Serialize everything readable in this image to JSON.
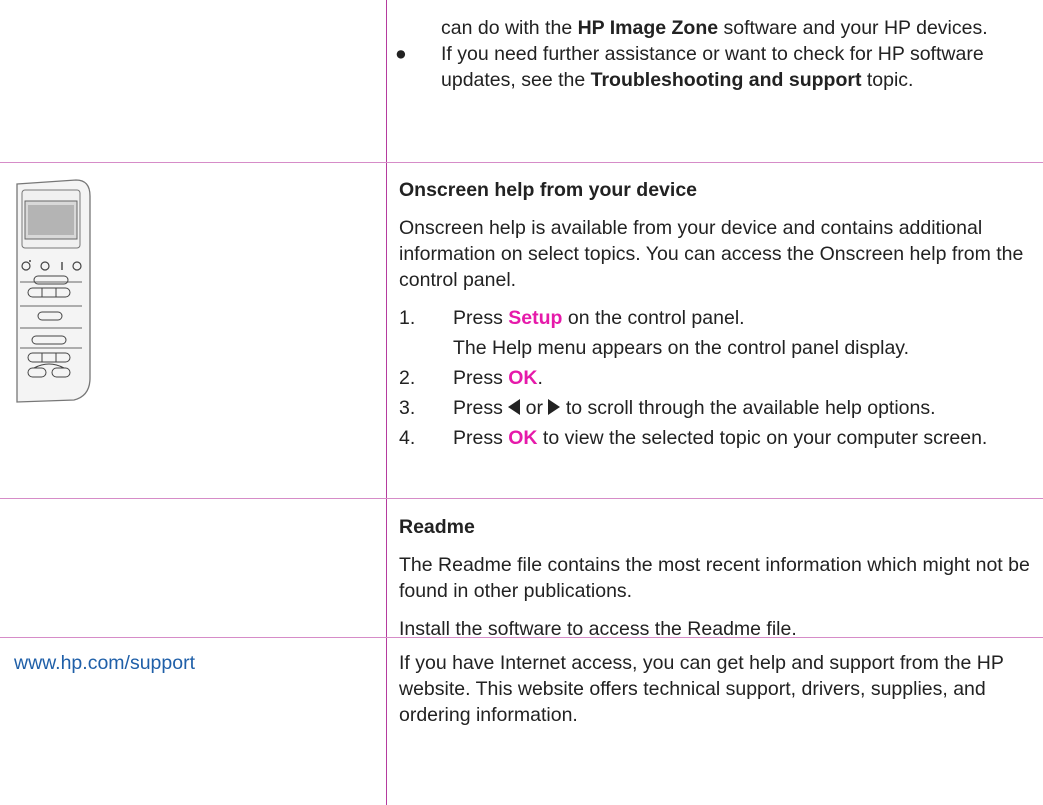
{
  "row1": {
    "intro_prefix": "can do with the ",
    "intro_bold": "HP Image Zone",
    "intro_suffix": " software and your HP devices.",
    "bullet": "●",
    "bullet_prefix": "If you need further assistance or want to check for HP software updates, see the ",
    "bullet_bold": "Troubleshooting and support",
    "bullet_suffix": " topic."
  },
  "row2": {
    "heading": "Onscreen help from your device",
    "description": "Onscreen help is available from your device and contains additional information on select topics. You can access the Onscreen help from the control panel.",
    "steps": [
      {
        "num": "1.",
        "prefix": "Press ",
        "key": "Setup",
        "suffix": " on the control panel."
      },
      {
        "num": "2.",
        "prefix": "Press ",
        "key": "OK",
        "suffix": "."
      },
      {
        "num": "3.",
        "prefix": "Press ",
        "mid": " or ",
        "suffix": " to scroll through the available help options."
      },
      {
        "num": "4.",
        "prefix": "Press ",
        "key": "OK",
        "suffix": " to view the selected topic on your computer screen."
      }
    ],
    "step1_sub": "The Help menu appears on the control panel display."
  },
  "row3": {
    "heading": "Readme",
    "description": "The Readme file contains the most recent information which might not be found in other publications.",
    "install": "Install the software to access the Readme file."
  },
  "row4": {
    "link": "www.hp.com/support",
    "description": "If you have Internet access, you can get help and support from the HP website. This website offers technical support, drivers, supplies, and ordering information."
  },
  "icons": {
    "left_arrow": "left-arrow-icon",
    "right_arrow": "right-arrow-icon",
    "control_panel": "control-panel-illustration"
  },
  "colors": {
    "rule": "#b53b9e",
    "key_highlight": "#e61aaa",
    "link": "#1f5fa8"
  }
}
